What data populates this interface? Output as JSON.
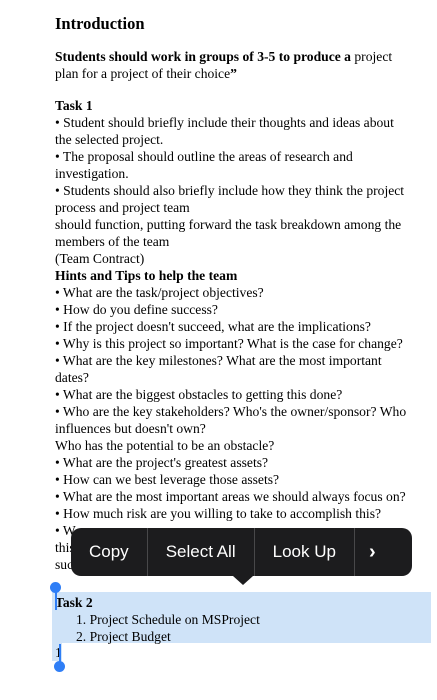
{
  "document": {
    "heading": "Introduction",
    "intro_bold": "Students should work in groups of 3-5 to produce a",
    "intro_rest_1": " project",
    "intro_line2": "plan for a project of their choice",
    "intro_quote": "”",
    "task1_title": "Task 1",
    "task1_lines": [
      "• Student should briefly include their thoughts and ideas about",
      "the selected project.",
      "• The proposal should outline the areas of research and",
      "investigation.",
      "• Students should also briefly include how they think the project",
      "process and project team",
      "should function, putting forward the task breakdown among the",
      "members of the team",
      "(Team Contract)"
    ],
    "hints_title": "Hints and Tips to help the team",
    "hints_lines": [
      "• What are the task/project objectives?",
      "• How do you define success?",
      "• If the project doesn't succeed, what are the implications?",
      "• Why is this project so important? What is the case for change?",
      "• What are the key milestones? What are the most important",
      "dates?",
      "• What are the biggest obstacles to getting this done?",
      "• Who are the key stakeholders? Who's the owner/sponsor? Who",
      "influences but doesn't own?",
      "Who has the potential to be an obstacle?",
      "• What are the project's greatest assets?",
      "• How can we best leverage those assets?",
      "• What are the most important areas we should always focus on?",
      "• How much risk are you willing to take to accomplish this?",
      "• W",
      "this",
      "suc"
    ],
    "task2_title": "Task 2",
    "task2_items": [
      "1. Project Schedule on MSProject",
      "2. Project Budget"
    ],
    "trailing_text": "1"
  },
  "context_menu": {
    "copy": "Copy",
    "select_all": "Select All",
    "look_up": "Look Up",
    "more": "›"
  },
  "colors": {
    "selection": "#cfe3f8",
    "handle": "#2f7ef6",
    "menu_bg": "#1c1c1e"
  }
}
